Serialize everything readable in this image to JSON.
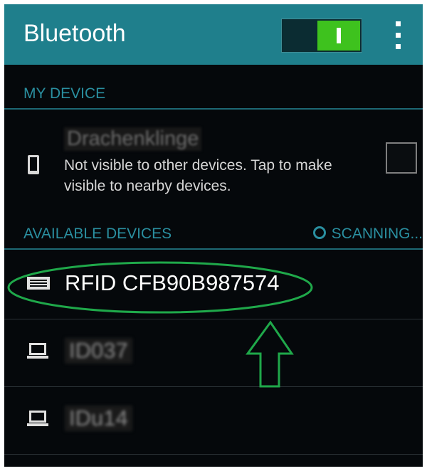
{
  "app_bar": {
    "title": "Bluetooth",
    "toggle_state": "on",
    "overflow_icon": "more-vert-icon",
    "accent_color": "#1f7f8c",
    "toggle_color": "#3ec21e"
  },
  "my_device": {
    "section_label": "MY DEVICE",
    "device_name": "Drachenklinge",
    "device_name_obscured": true,
    "icon": "phone-icon",
    "description": "Not visible to other devices. Tap to make visible to nearby devices.",
    "visible_checked": false
  },
  "available_devices": {
    "section_label": "AVAILABLE DEVICES",
    "status": "SCANNING...",
    "status_icon": "spinner-icon",
    "items": [
      {
        "name": "RFID CFB90B987574",
        "icon": "keyboard-icon",
        "obscured": false,
        "highlighted": true
      },
      {
        "name": "ID037",
        "icon": "laptop-icon",
        "obscured": true
      },
      {
        "name": "IDu14",
        "icon": "laptop-icon",
        "obscured": true
      }
    ]
  },
  "annotation": {
    "highlight_color": "#1fa84a",
    "shapes": [
      "ellipse-around-first-device",
      "up-arrow"
    ]
  }
}
